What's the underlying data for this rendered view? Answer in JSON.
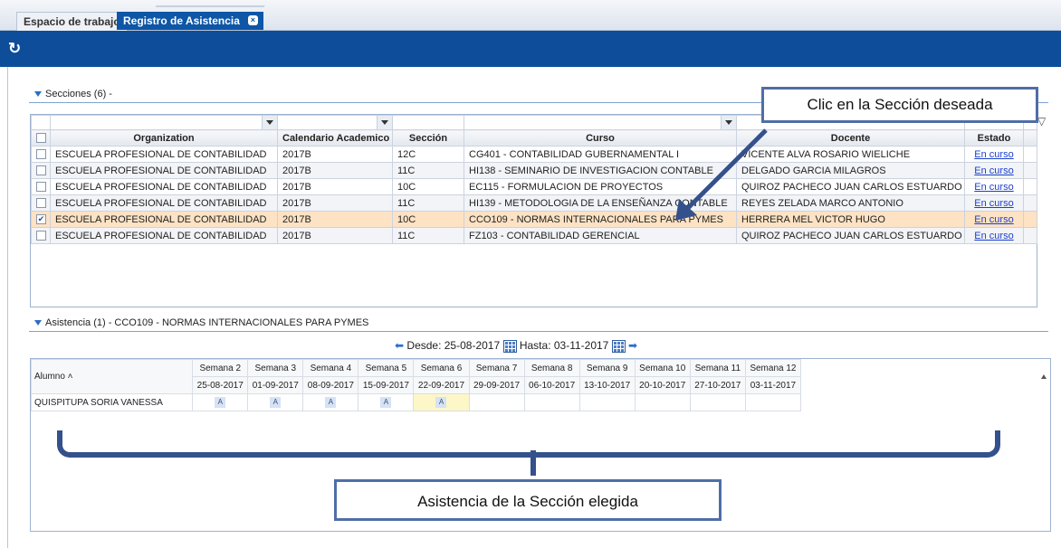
{
  "tabs": [
    {
      "label": "Espacio de trabajo"
    },
    {
      "label": "Registro de Asistencia",
      "close": "×"
    }
  ],
  "toolbar": {
    "refresh_icon": "refresh-icon"
  },
  "secciones": {
    "header": "Secciones (6) -",
    "columns": [
      "Organization",
      "Calendario Academico",
      "Sección",
      "Curso",
      "Docente",
      "Estado"
    ],
    "rows": [
      {
        "org": "ESCUELA PROFESIONAL DE CONTABILIDAD",
        "cal": "2017B",
        "sec": "12C",
        "curso": "CG401 - CONTABILIDAD GUBERNAMENTAL I",
        "docente": "VICENTE ALVA ROSARIO WIELICHE",
        "estado": "En curso",
        "checked": false
      },
      {
        "org": "ESCUELA PROFESIONAL DE CONTABILIDAD",
        "cal": "2017B",
        "sec": "11C",
        "curso": "HI138 - SEMINARIO DE INVESTIGACION CONTABLE",
        "docente": "DELGADO GARCIA MILAGROS",
        "estado": "En curso",
        "checked": false
      },
      {
        "org": "ESCUELA PROFESIONAL DE CONTABILIDAD",
        "cal": "2017B",
        "sec": "10C",
        "curso": "EC115 - FORMULACION DE PROYECTOS",
        "docente": "QUIROZ PACHECO JUAN CARLOS ESTUARDO",
        "estado": "En curso",
        "checked": false
      },
      {
        "org": "ESCUELA PROFESIONAL DE CONTABILIDAD",
        "cal": "2017B",
        "sec": "11C",
        "curso": "HI139 - METODOLOGIA DE LA ENSEÑANZA CONTABLE",
        "docente": "REYES ZELADA MARCO ANTONIO",
        "estado": "En curso",
        "checked": false
      },
      {
        "org": "ESCUELA PROFESIONAL DE CONTABILIDAD",
        "cal": "2017B",
        "sec": "10C",
        "curso": "CCO109 - NORMAS INTERNACIONALES PARA PYMES",
        "docente": "HERRERA MEL VICTOR HUGO",
        "estado": "En curso",
        "checked": true
      },
      {
        "org": "ESCUELA PROFESIONAL DE CONTABILIDAD",
        "cal": "2017B",
        "sec": "11C",
        "curso": "FZ103 - CONTABILIDAD GERENCIAL",
        "docente": "QUIROZ PACHECO JUAN CARLOS ESTUARDO",
        "estado": "En curso",
        "checked": false
      }
    ]
  },
  "asistencia": {
    "header": "Asistencia (1) - CCO109 - NORMAS INTERNACIONALES PARA PYMES",
    "desde_label": "Desde: 25-08-2017",
    "hasta_label": "Hasta: 03-11-2017",
    "alumno_col": "Alumno",
    "weeks": [
      "Semana 2",
      "Semana 3",
      "Semana 4",
      "Semana 5",
      "Semana 6",
      "Semana 7",
      "Semana 8",
      "Semana 9",
      "Semana 10",
      "Semana 11",
      "Semana 12"
    ],
    "dates": [
      "25-08-2017",
      "01-09-2017",
      "08-09-2017",
      "15-09-2017",
      "22-09-2017",
      "29-09-2017",
      "06-10-2017",
      "13-10-2017",
      "20-10-2017",
      "27-10-2017",
      "03-11-2017"
    ],
    "students": [
      {
        "name": "QUISPITUPA SORIA VANESSA",
        "marks": [
          "A",
          "A",
          "A",
          "A",
          "A",
          "",
          "",
          "",
          "",
          "",
          ""
        ]
      }
    ]
  },
  "annotations": {
    "callout_top": "Clic en la Sección deseada",
    "callout_bottom": "Asistencia de la Sección elegida"
  },
  "colors": {
    "toolbar": "#0e4d9a",
    "selected_row": "#fde2c4",
    "callout_border": "#4f6ea6"
  }
}
